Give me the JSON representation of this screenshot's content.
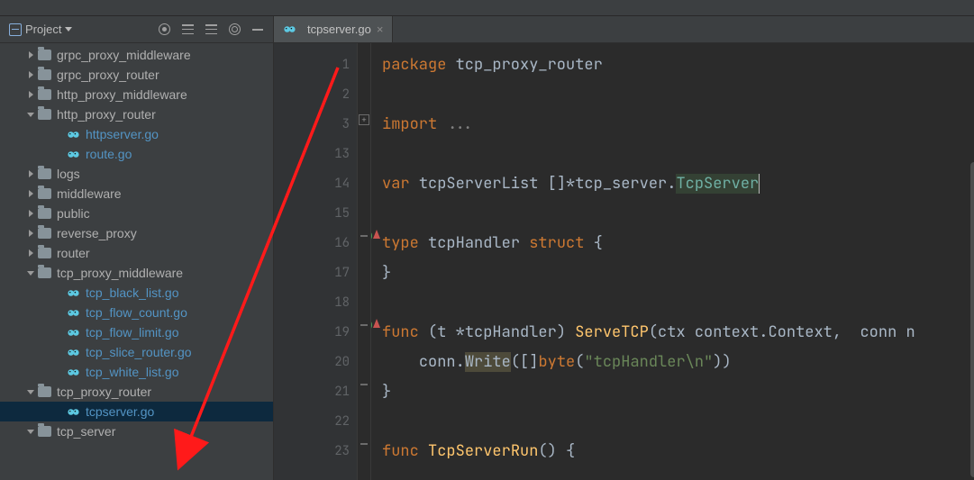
{
  "sidebar": {
    "title": "Project",
    "items": [
      {
        "kind": "folder",
        "label": "grpc_proxy_middleware",
        "indent": 28,
        "arrow": "right"
      },
      {
        "kind": "folder",
        "label": "grpc_proxy_router",
        "indent": 28,
        "arrow": "right"
      },
      {
        "kind": "folder",
        "label": "http_proxy_middleware",
        "indent": 28,
        "arrow": "right"
      },
      {
        "kind": "folder",
        "label": "http_proxy_router",
        "indent": 28,
        "arrow": "down"
      },
      {
        "kind": "file",
        "label": "httpserver.go",
        "indent": 60,
        "arrow": "none"
      },
      {
        "kind": "file",
        "label": "route.go",
        "indent": 60,
        "arrow": "none"
      },
      {
        "kind": "folder",
        "label": "logs",
        "indent": 28,
        "arrow": "right"
      },
      {
        "kind": "folder",
        "label": "middleware",
        "indent": 28,
        "arrow": "right"
      },
      {
        "kind": "folder",
        "label": "public",
        "indent": 28,
        "arrow": "right"
      },
      {
        "kind": "folder",
        "label": "reverse_proxy",
        "indent": 28,
        "arrow": "right"
      },
      {
        "kind": "folder",
        "label": "router",
        "indent": 28,
        "arrow": "right"
      },
      {
        "kind": "folder",
        "label": "tcp_proxy_middleware",
        "indent": 28,
        "arrow": "down"
      },
      {
        "kind": "file",
        "label": "tcp_black_list.go",
        "indent": 60,
        "arrow": "none"
      },
      {
        "kind": "file",
        "label": "tcp_flow_count.go",
        "indent": 60,
        "arrow": "none"
      },
      {
        "kind": "file",
        "label": "tcp_flow_limit.go",
        "indent": 60,
        "arrow": "none"
      },
      {
        "kind": "file",
        "label": "tcp_slice_router.go",
        "indent": 60,
        "arrow": "none"
      },
      {
        "kind": "file",
        "label": "tcp_white_list.go",
        "indent": 60,
        "arrow": "none"
      },
      {
        "kind": "folder",
        "label": "tcp_proxy_router",
        "indent": 28,
        "arrow": "down"
      },
      {
        "kind": "file",
        "label": "tcpserver.go",
        "indent": 60,
        "arrow": "none",
        "selected": true
      },
      {
        "kind": "folder",
        "label": "tcp_server",
        "indent": 28,
        "arrow": "down"
      }
    ]
  },
  "tabs": [
    {
      "label": "tcpserver.go"
    }
  ],
  "editor": {
    "gutter": [
      "1",
      "2",
      "3",
      "13",
      "14",
      "15",
      "16",
      "17",
      "18",
      "19",
      "20",
      "21",
      "22",
      "23"
    ],
    "lines": [
      {
        "html": "<span class='kw'>package</span> <span class='ident'>tcp_proxy_router</span>"
      },
      {
        "html": ""
      },
      {
        "html": "<span class='kw'>import</span> <span class='dim'>...</span>"
      },
      {
        "html": ""
      },
      {
        "html": "<span class='kw'>var</span> <span class='ident'>tcpServerList</span> []*<span class='ident'>tcp_server</span>.<span class='typeRef'>TcpServer</span><span class='cursor'></span>"
      },
      {
        "html": ""
      },
      {
        "html": "<span class='kw'>type</span> <span class='ident'>tcpHandler</span> <span class='kw'>struct</span> {"
      },
      {
        "html": "}"
      },
      {
        "html": ""
      },
      {
        "html": "<span class='kw'>func</span> (<span class='param'>t</span> *<span class='ident'>tcpHandler</span>) <span class='fn'>ServeTCP</span>(<span class='param'>ctx</span> <span class='ident'>context</span>.<span class='type'>Context</span>,  <span class='param'>conn</span> n"
      },
      {
        "html": "    <span class='ident'>conn</span>.<span class='writeFn'>Write</span>([]<span class='kw'>byte</span>(<span class='str'>\"tcpHandler\\n\"</span>))"
      },
      {
        "html": "}"
      },
      {
        "html": ""
      },
      {
        "html": "<span class='kw'>func</span> <span class='fn'>TcpServerRun</span>() {"
      }
    ]
  }
}
